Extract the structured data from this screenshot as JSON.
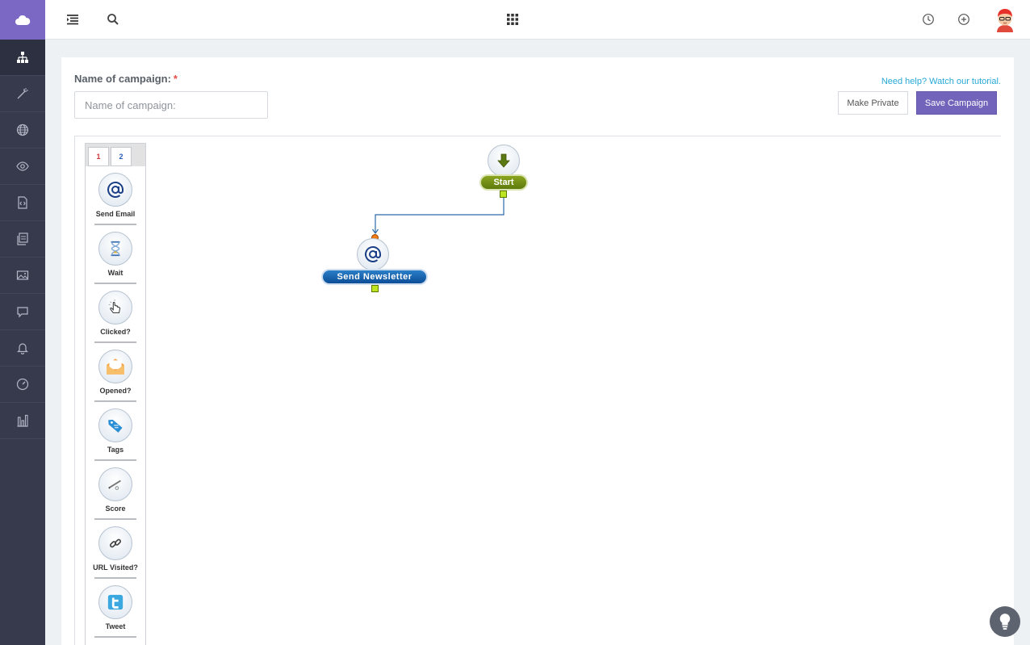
{
  "sidebar": {
    "items": [
      {
        "name": "org-chart-icon"
      },
      {
        "name": "magic-wand-icon"
      },
      {
        "name": "globe-icon"
      },
      {
        "name": "eye-icon"
      },
      {
        "name": "code-file-icon"
      },
      {
        "name": "documents-icon"
      },
      {
        "name": "image-icon"
      },
      {
        "name": "chat-icon"
      },
      {
        "name": "bell-icon"
      },
      {
        "name": "gauge-icon"
      },
      {
        "name": "bar-chart-icon"
      }
    ]
  },
  "form": {
    "name_label": "Name of campaign:",
    "required_mark": "*",
    "name_placeholder": "Name of campaign:",
    "name_value": "",
    "help_link": "Need help? Watch our tutorial.",
    "make_private": "Make Private",
    "save": "Save Campaign"
  },
  "palette": {
    "tabs": [
      "1",
      "2"
    ],
    "items": [
      {
        "label": "Send Email",
        "icon": "at-icon"
      },
      {
        "label": "Wait",
        "icon": "hourglass-icon"
      },
      {
        "label": "Clicked?",
        "icon": "pointer-icon"
      },
      {
        "label": "Opened?",
        "icon": "envelope-icon"
      },
      {
        "label": "Tags",
        "icon": "tag-icon"
      },
      {
        "label": "Score",
        "icon": "pencil-icon"
      },
      {
        "label": "URL Visited?",
        "icon": "link-icon"
      },
      {
        "label": "Tweet",
        "icon": "twitter-icon"
      }
    ]
  },
  "flow": {
    "start_label": "Start",
    "newsletter_label": "Send Newsletter"
  },
  "colors": {
    "sidebar": "#363a4c",
    "logo": "#7b68c4",
    "accent_button": "#7263bb",
    "link": "#27a9d6",
    "start_pill": "#6f8c14",
    "newsletter_pill": "#1765b0"
  }
}
